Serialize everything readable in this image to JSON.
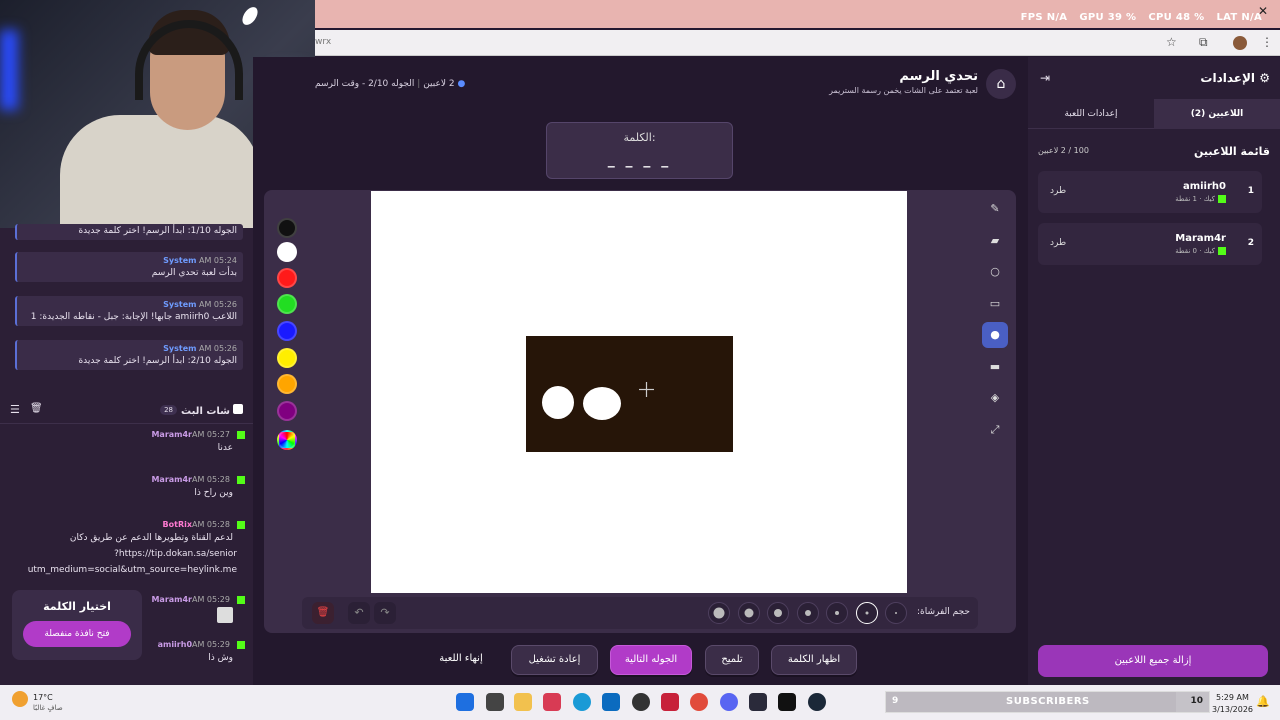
{
  "system_stats": {
    "fps_label": "FPS",
    "fps": "N/A",
    "gpu_label": "GPU",
    "gpu": "39 %",
    "cpu_label": "CPU",
    "cpu": "48 %",
    "lat_label": "LAT",
    "lat": "N/A"
  },
  "browser": {
    "url_fragment": "wrx"
  },
  "game": {
    "title": "تحدي الرسم",
    "subtitle": "لعبة تعتمد على الشات يخمن رسمة الستريمر",
    "round_info": "الجوله 2/10 - وقت الرسم",
    "players_count": "2 لاعبين",
    "word_label": "الكلمة:",
    "word_mask": "_ _ _ _",
    "brush_size_label": "حجم الفرشاة:"
  },
  "colors": [
    "#111111",
    "#ffffff",
    "#ff1a1a",
    "#22dd22",
    "#1a1aff",
    "#ffee00",
    "#ffa500",
    "#800080"
  ],
  "system_messages": [
    {
      "name": "System",
      "time": "AM 05:24",
      "text": "الجوله 1/10: ابدأ الرسم! اختر كلمة جديدة"
    },
    {
      "name": "System",
      "time": "AM 05:24",
      "text": "بدأت لعبة تحدي الرسم"
    },
    {
      "name": "System",
      "time": "AM 05:26",
      "text": "اللاعب amiirh0 جابها! الإجابة: جبل - نقاطه الجديدة: 1"
    },
    {
      "name": "System",
      "time": "AM 05:26",
      "text": "الجوله 2/10: ابدأ الرسم! اختر كلمة جديدة"
    }
  ],
  "chat": {
    "title": "شات البث",
    "count": "28",
    "messages": [
      {
        "name": "Maram4r",
        "time": "AM 05:27",
        "text": "عدنا"
      },
      {
        "name": "Maram4r",
        "time": "AM 05:28",
        "text": "وين راح ذا"
      },
      {
        "name": "BotRix",
        "time": "AM 05:28",
        "text": "لدعم القناة وتطويرها الدعم عن طريق دكان"
      },
      {
        "name": "",
        "time": "",
        "text": "https://tip.dokan.sa/senior?"
      },
      {
        "name": "",
        "time": "",
        "text": "utm_medium=social&utm_source=heylink.me"
      },
      {
        "name": "Maram4r",
        "time": "AM 05:29",
        "text": ""
      },
      {
        "name": "amiirh0",
        "time": "AM 05:29",
        "text": "وش ذا"
      }
    ]
  },
  "word_picker": {
    "title": "اختيار الكلمة",
    "button": "فتح نافذة منفصلة"
  },
  "actions": {
    "show_word": "اظهار الكلمة",
    "hint": "تلميح",
    "next_round": "الجوله التالية",
    "restart": "إعادة تشغيل",
    "end_game": "إنهاء اللعبة"
  },
  "settings": {
    "title": "الإعدادات",
    "tab_players": "اللاعبين (2)",
    "tab_game": "إعدادات اللعبة",
    "list_title": "قائمة اللاعبين",
    "list_count": "100 / 2 لاعبين",
    "players": [
      {
        "rank": "1",
        "name": "amiirh0",
        "points": "كيك · 1 نقطة",
        "kick": "طرد"
      },
      {
        "rank": "2",
        "name": "Maram4r",
        "points": "كيك · 0 نقطة",
        "kick": "طرد"
      }
    ],
    "remove_all": "إزالة جميع اللاعبين"
  },
  "taskbar": {
    "temp": "17°C",
    "weather": "صافٍ غالبًا",
    "time": "5:29 AM",
    "date": "3/13/2026",
    "subs_count": "9",
    "subs_label": "SUBSCRIBERS",
    "subs_goal": "10"
  }
}
